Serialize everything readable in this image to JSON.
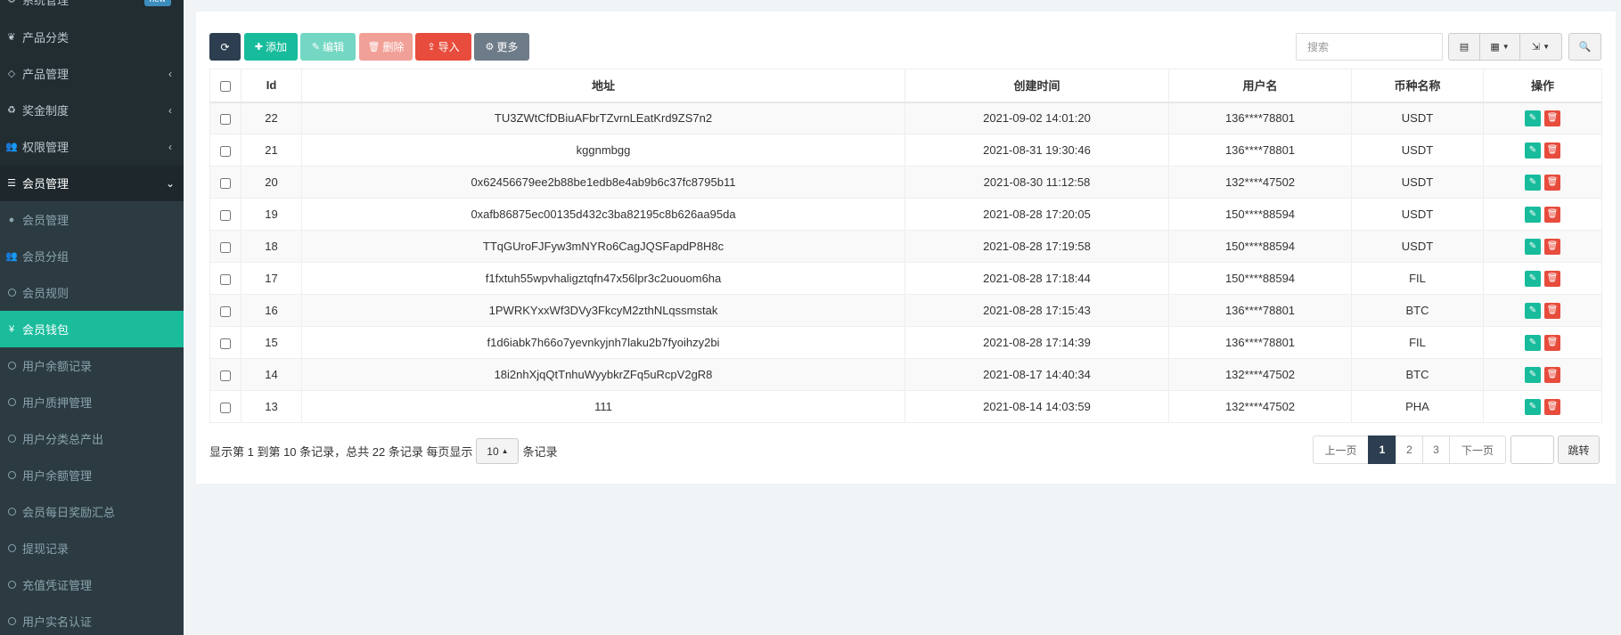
{
  "sidebar": {
    "items": [
      {
        "label": "系统管理",
        "icon": "gears-icon",
        "badge": "new"
      },
      {
        "label": "产品分类",
        "icon": "leaf-icon"
      },
      {
        "label": "产品管理",
        "icon": "diamond-icon",
        "arrow": "‹"
      },
      {
        "label": "奖金制度",
        "icon": "recycle-icon",
        "arrow": "‹"
      },
      {
        "label": "权限管理",
        "icon": "group-icon",
        "arrow": "‹"
      },
      {
        "label": "会员管理",
        "icon": "list-icon",
        "arrow": "⌄"
      },
      {
        "label": "会员管理",
        "icon": "user-icon"
      },
      {
        "label": "会员分组",
        "icon": "users-icon"
      },
      {
        "label": "会员规则",
        "icon": "circle-icon"
      },
      {
        "label": "会员钱包",
        "icon": "yen-icon"
      },
      {
        "label": "用户余额记录",
        "icon": "circle-icon"
      },
      {
        "label": "用户质押管理",
        "icon": "circle-icon"
      },
      {
        "label": "用户分类总产出",
        "icon": "circle-icon"
      },
      {
        "label": "用户余额管理",
        "icon": "circle-icon"
      },
      {
        "label": "会员每日奖励汇总",
        "icon": "circle-icon"
      },
      {
        "label": "提现记录",
        "icon": "circle-icon"
      },
      {
        "label": "充值凭证管理",
        "icon": "circle-icon"
      },
      {
        "label": "用户实名认证",
        "icon": "circle-icon"
      }
    ]
  },
  "toolbar": {
    "add_label": "添加",
    "edit_label": "编辑",
    "delete_label": "删除",
    "import_label": "导入",
    "more_label": "更多",
    "search_placeholder": "搜索"
  },
  "table": {
    "headers": [
      "Id",
      "地址",
      "创建时间",
      "用户名",
      "币种名称",
      "操作"
    ],
    "rows": [
      {
        "id": "22",
        "address": "TU3ZWtCfDBiuAFbrTZvrnLEatKrd9ZS7n2",
        "created": "2021-09-02 14:01:20",
        "username": "136****78801",
        "coin": "USDT"
      },
      {
        "id": "21",
        "address": "kggnmbgg",
        "created": "2021-08-31 19:30:46",
        "username": "136****78801",
        "coin": "USDT"
      },
      {
        "id": "20",
        "address": "0x62456679ee2b88be1edb8e4ab9b6c37fc8795b11",
        "created": "2021-08-30 11:12:58",
        "username": "132****47502",
        "coin": "USDT"
      },
      {
        "id": "19",
        "address": "0xafb86875ec00135d432c3ba82195c8b626aa95da",
        "created": "2021-08-28 17:20:05",
        "username": "150****88594",
        "coin": "USDT"
      },
      {
        "id": "18",
        "address": "TTqGUroFJFyw3mNYRo6CagJQSFapdP8H8c",
        "created": "2021-08-28 17:19:58",
        "username": "150****88594",
        "coin": "USDT"
      },
      {
        "id": "17",
        "address": "f1fxtuh55wpvhaligztqfn47x56lpr3c2uouom6ha",
        "created": "2021-08-28 17:18:44",
        "username": "150****88594",
        "coin": "FIL"
      },
      {
        "id": "16",
        "address": "1PWRKYxxWf3DVy3FkcyM2zthNLqssmstak",
        "created": "2021-08-28 17:15:43",
        "username": "136****78801",
        "coin": "BTC"
      },
      {
        "id": "15",
        "address": "f1d6iabk7h66o7yevnkyjnh7laku2b7fyoihzy2bi",
        "created": "2021-08-28 17:14:39",
        "username": "136****78801",
        "coin": "FIL"
      },
      {
        "id": "14",
        "address": "18i2nhXjqQtTnhuWyybkrZFq5uRcpV2gR8",
        "created": "2021-08-17 14:40:34",
        "username": "132****47502",
        "coin": "BTC"
      },
      {
        "id": "13",
        "address": "111",
        "created": "2021-08-14 14:03:59",
        "username": "132****47502",
        "coin": "PHA"
      }
    ]
  },
  "footer": {
    "info_prefix": "显示第 1 到第 10 条记录，总共 22 条记录 每页显示",
    "page_size": "10",
    "info_suffix": "条记录",
    "prev_label": "上一页",
    "pages": [
      "1",
      "2",
      "3"
    ],
    "next_label": "下一页",
    "jump_label": "跳转"
  },
  "colors": {
    "sidebar_bg": "#222d32",
    "active_item": "#1abc9c",
    "primary_dark": "#2c3e50",
    "success": "#18bc9c",
    "danger": "#e74c3c"
  }
}
